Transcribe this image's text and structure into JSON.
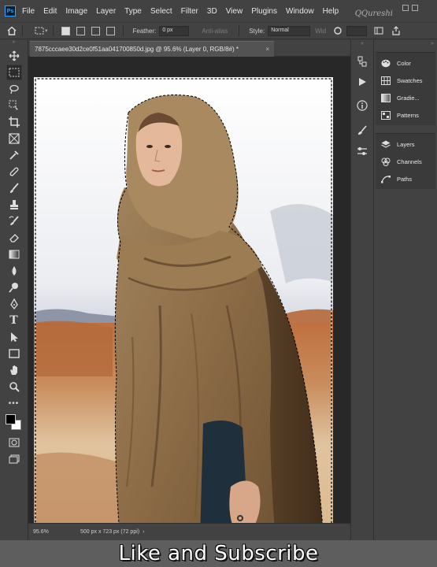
{
  "app": {
    "logo_text": "Ps"
  },
  "menu": [
    "File",
    "Edit",
    "Image",
    "Layer",
    "Type",
    "Select",
    "Filter",
    "3D",
    "View",
    "Plugins",
    "Window",
    "Help"
  ],
  "watermark": "QQureshi",
  "options_bar": {
    "feather_label": "Feather:",
    "feather_value": "0 px",
    "antialias_label": "Anti-alias",
    "style_label": "Style:",
    "style_value": "Normal",
    "width_label": "Wid"
  },
  "document": {
    "tab_title": "7875cccaee30d2ce0f51aa041700850d.jpg @ 95.6% (Layer 0, RGB/8#) *",
    "close_glyph": "×"
  },
  "status_bar": {
    "zoom": "95.6%",
    "size": "500 px x 723 px (72 ppi)"
  },
  "panels": {
    "group1": [
      {
        "label": "Color",
        "icon": "palette-icon"
      },
      {
        "label": "Swatches",
        "icon": "grid-icon"
      },
      {
        "label": "Gradie...",
        "icon": "gradient-icon"
      },
      {
        "label": "Patterns",
        "icon": "pattern-icon"
      }
    ],
    "group2": [
      {
        "label": "Layers",
        "icon": "layers-icon"
      },
      {
        "label": "Channels",
        "icon": "channels-icon"
      },
      {
        "label": "Paths",
        "icon": "paths-icon"
      }
    ]
  },
  "banner": {
    "text": "Like and Subscribe"
  },
  "colors": {
    "chrome_dark": "#424242",
    "workspace": "#282828",
    "accent_blue": "#31a8ff"
  }
}
